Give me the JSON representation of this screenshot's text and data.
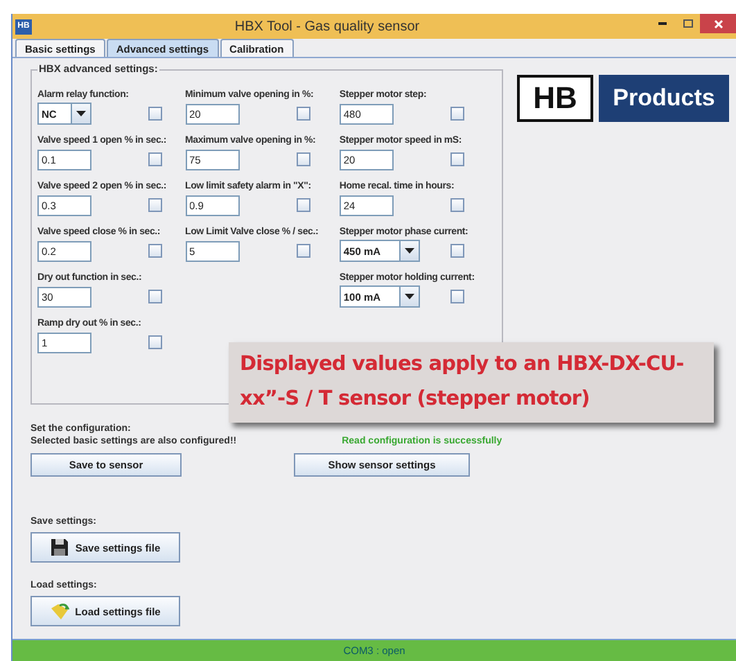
{
  "window": {
    "title": "HBX Tool - Gas quality sensor",
    "app_icon": "HB"
  },
  "tabs": [
    {
      "label": "Basic settings",
      "selected": false
    },
    {
      "label": "Advanced settings",
      "selected": true
    },
    {
      "label": "Calibration",
      "selected": false
    }
  ],
  "advanced": {
    "title": "HBX advanced settings:",
    "columns": [
      [
        {
          "label": "Alarm relay function:",
          "kind": "select",
          "value": "NC",
          "checked": false
        },
        {
          "label": "Valve speed 1 open % in sec.:",
          "kind": "text",
          "value": "0.1",
          "checked": false
        },
        {
          "label": "Valve speed 2 open % in sec.:",
          "kind": "text",
          "value": "0.3",
          "checked": false
        },
        {
          "label": "Valve speed close % in sec.:",
          "kind": "text",
          "value": "0.2",
          "checked": false
        },
        {
          "label": "Dry out function in sec.:",
          "kind": "text",
          "value": "30",
          "checked": false
        },
        {
          "label": "Ramp dry out % in sec.:",
          "kind": "text",
          "value": "1",
          "checked": false
        }
      ],
      [
        {
          "label": "Minimum valve opening in %:",
          "kind": "text",
          "value": "20",
          "checked": false
        },
        {
          "label": "Maximum valve opening in %:",
          "kind": "text",
          "value": "75",
          "checked": false
        },
        {
          "label": "Low limit safety alarm in \"X\":",
          "kind": "text",
          "value": "0.9",
          "checked": false
        },
        {
          "label": "Low Limit Valve close % / sec.:",
          "kind": "text",
          "value": "5",
          "checked": false
        }
      ],
      [
        {
          "label": "Stepper motor step:",
          "kind": "text",
          "value": "480",
          "checked": false
        },
        {
          "label": "Stepper motor speed in mS:",
          "kind": "text",
          "value": "20",
          "checked": false
        },
        {
          "label": "Home recal. time in hours:",
          "kind": "text",
          "value": "24",
          "checked": false
        },
        {
          "label": "Stepper motor phase current:",
          "kind": "select",
          "value": "450 mA",
          "checked": false
        },
        {
          "label": "Stepper motor holding current:",
          "kind": "select",
          "value": "100 mA",
          "checked": false
        }
      ]
    ]
  },
  "logo": {
    "initials": "HB",
    "word": "Products"
  },
  "callout": [
    "Displayed values apply to an HBX-DX-CU-",
    "xx”-S / T sensor (stepper motor)"
  ],
  "configuration": {
    "title": "Set the configuration:",
    "note": "Selected basic settings are also configured!!",
    "status": "Read configuration is successfully",
    "buttons": [
      "Save to sensor",
      "Show sensor settings"
    ]
  },
  "save": {
    "label": "Save settings:",
    "button": "Save settings file"
  },
  "load": {
    "label": "Load settings:",
    "button": "Load settings file"
  },
  "status_bar": "COM3 : open"
}
